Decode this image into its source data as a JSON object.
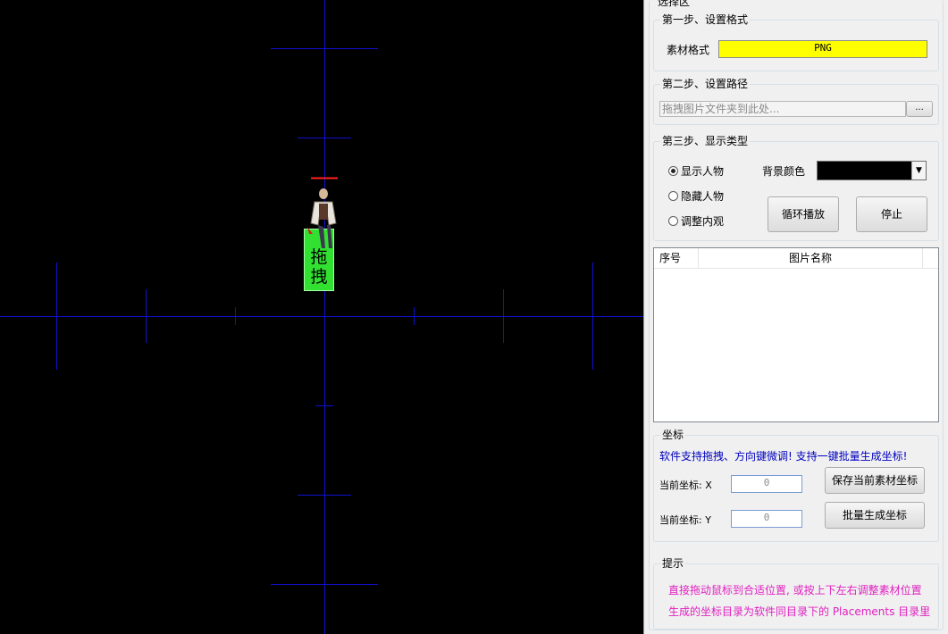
{
  "canvas": {
    "background": "#000000",
    "crosshair_color": "#1010d0",
    "drag_tag_chars": [
      "拖",
      "拽"
    ],
    "drag_tag_color": "#32e032",
    "marker_color": "#ff2020"
  },
  "panel": {
    "top_group_title": "选择区",
    "step1": {
      "title": "第一步、设置格式",
      "format_label": "素材格式",
      "format_value": "PNG",
      "format_color": "#ffff00"
    },
    "step2": {
      "title": "第二步、设置路径",
      "path_placeholder": "拖拽图片文件夹到此处...",
      "browse_label": "..."
    },
    "step3": {
      "title": "第三步、显示类型",
      "radios": [
        {
          "label": "显示人物",
          "checked": true
        },
        {
          "label": "隐藏人物",
          "checked": false
        },
        {
          "label": "调整内观",
          "checked": false
        }
      ],
      "bg_color_label": "背景颜色",
      "bg_color_value": "#000000",
      "loop_button": "循环播放",
      "stop_button": "停止"
    },
    "list": {
      "columns": [
        "序号",
        "图片名称"
      ]
    },
    "coords": {
      "title": "坐标",
      "hint": "软件支持拖拽、方向键微调! 支持一键批量生成坐标!",
      "hint_color": "#0000c0",
      "x_label": "当前坐标: X",
      "x_value": "0",
      "y_label": "当前坐标: Y",
      "y_value": "0",
      "save_button": "保存当前素材坐标",
      "batch_button": "批量生成坐标"
    },
    "tips": {
      "title": "提示",
      "line1": "直接拖动鼠标到合适位置, 或按上下左右调整素材位置",
      "line2": "生成的坐标目录为软件同目录下的 Placements 目录里",
      "color": "#e020c0"
    }
  }
}
